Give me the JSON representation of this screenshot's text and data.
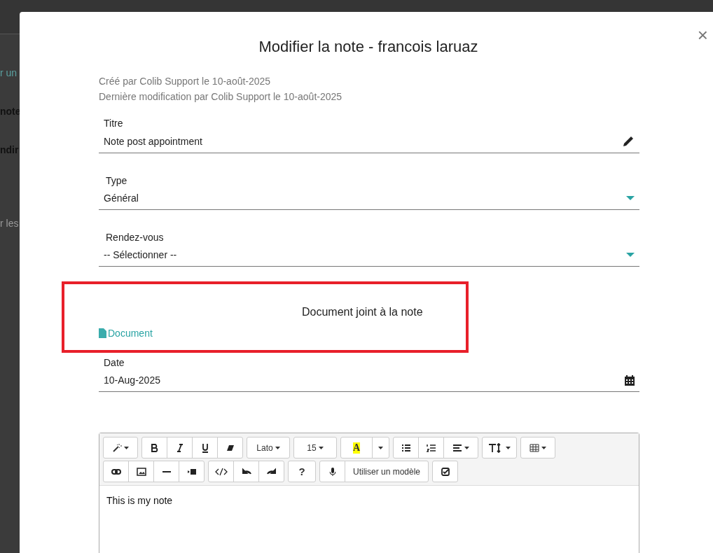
{
  "background": {
    "fragments": [
      {
        "text": "r un",
        "kind": "link"
      },
      {
        "text": "note",
        "kind": "bold"
      },
      {
        "text": "ndir",
        "kind": "bold"
      },
      {
        "text": "r les",
        "kind": "muted"
      }
    ]
  },
  "modal": {
    "title": "Modifier la note - francois laruaz",
    "close": "×",
    "meta": [
      "Créé par Colib Support le 10-août-2025",
      "Dernière modification par Colib Support le 10-août-2025"
    ],
    "fields": [
      {
        "label": "Titre",
        "value": "Note post appointment",
        "kind": "text"
      },
      {
        "label": "Type",
        "value": "Général",
        "kind": "select"
      },
      {
        "label": "Rendez-vous",
        "value": "-- Sélectionner --",
        "kind": "select"
      }
    ],
    "attachment": {
      "heading": "Document joint à la note",
      "link": "Document",
      "highlighted": true
    },
    "date": {
      "label": "Date",
      "value": "10-Aug-2025",
      "kind": "date"
    },
    "editor": {
      "toolbar": [
        [
          [
            {
              "kind": "magic"
            }
          ],
          [
            {
              "kind": "bold"
            },
            {
              "kind": "italic"
            },
            {
              "kind": "underline"
            },
            {
              "kind": "eraser"
            }
          ],
          [
            {
              "kind": "text",
              "label": "Lato"
            }
          ],
          [
            {
              "kind": "text",
              "label": "15"
            }
          ],
          [
            {
              "kind": "color",
              "label": "A"
            },
            {
              "kind": "caret"
            }
          ],
          [
            {
              "kind": "ul"
            },
            {
              "kind": "ol"
            },
            {
              "kind": "align"
            }
          ],
          [
            {
              "kind": "height"
            }
          ],
          [
            {
              "kind": "table"
            }
          ]
        ],
        [
          [
            {
              "kind": "link"
            },
            {
              "kind": "image"
            },
            {
              "kind": "hr"
            },
            {
              "kind": "video"
            }
          ],
          [
            {
              "kind": "code"
            },
            {
              "kind": "undo"
            },
            {
              "kind": "redo"
            }
          ],
          [
            {
              "kind": "help",
              "label": "?"
            }
          ],
          [
            {
              "kind": "mic"
            },
            {
              "kind": "plain",
              "label": "Utiliser un modèle"
            }
          ],
          [
            {
              "kind": "check"
            }
          ]
        ]
      ],
      "content": "This is my note"
    }
  }
}
